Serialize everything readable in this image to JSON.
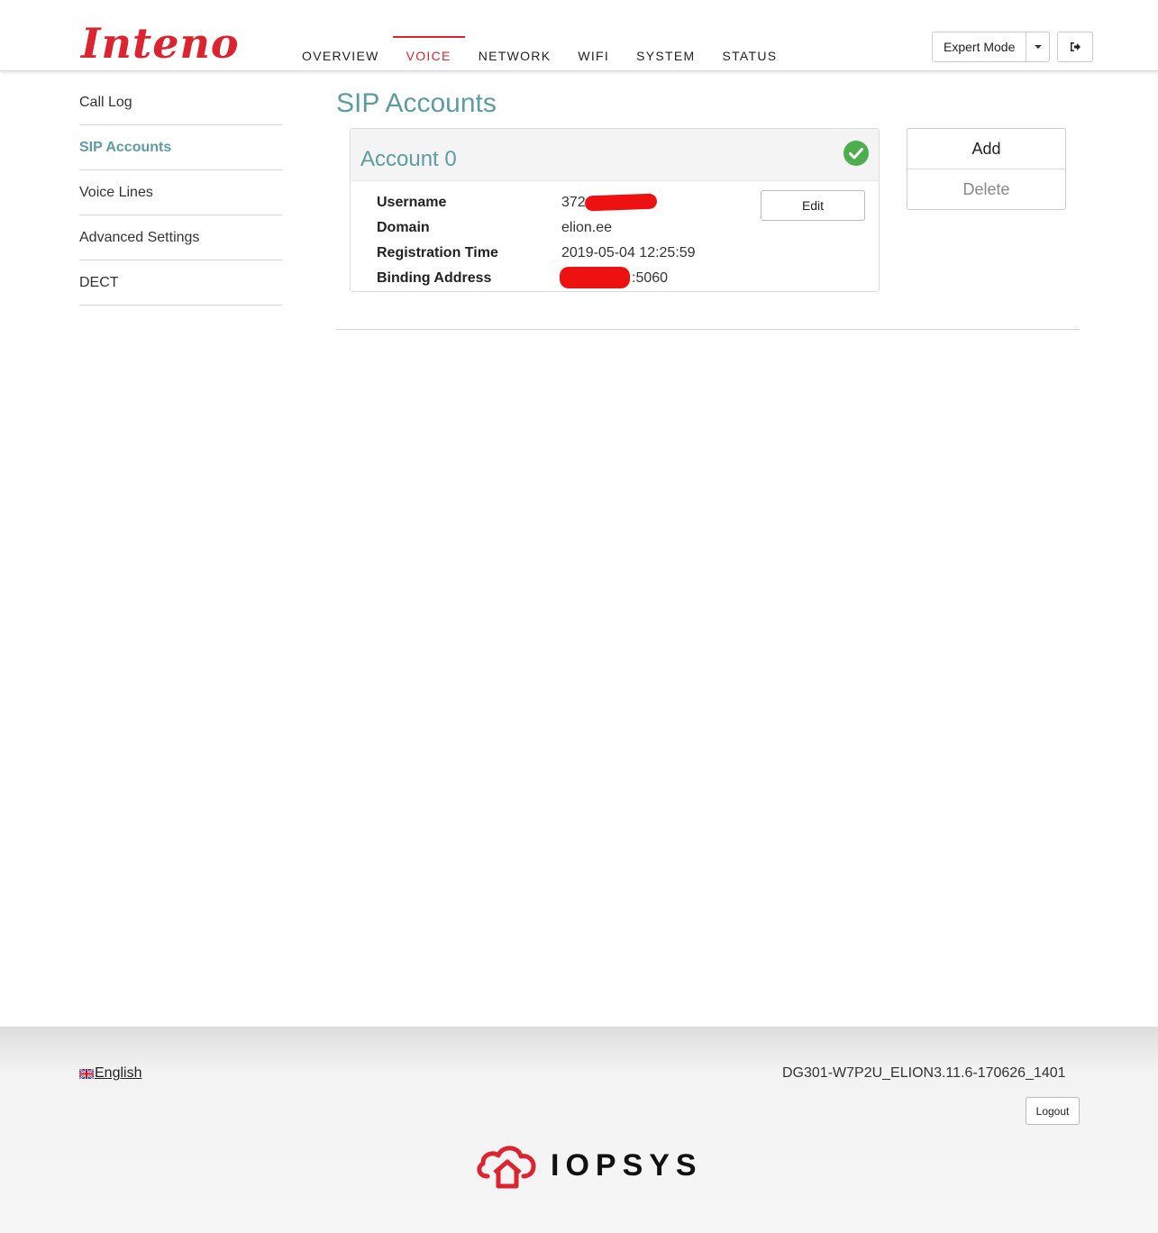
{
  "brand": {
    "logo_text": "Inteno",
    "accent": "#dc2430",
    "teal": "#5d9ca3"
  },
  "nav": {
    "items": [
      {
        "label": "OVERVIEW"
      },
      {
        "label": "VOICE"
      },
      {
        "label": "NETWORK"
      },
      {
        "label": "WIFI"
      },
      {
        "label": "SYSTEM"
      },
      {
        "label": "STATUS"
      }
    ],
    "active": "VOICE"
  },
  "header_controls": {
    "mode_label": "Expert Mode",
    "mode_dropdown_icon": "caret-down-icon",
    "exit_icon": "sign-out-icon"
  },
  "sidebar": {
    "items": [
      {
        "label": "Call Log"
      },
      {
        "label": "SIP Accounts"
      },
      {
        "label": "Voice Lines"
      },
      {
        "label": "Advanced Settings"
      },
      {
        "label": "DECT"
      }
    ],
    "active": "SIP Accounts"
  },
  "main": {
    "title": "SIP Accounts",
    "account": {
      "title": "Account 0",
      "status_icon": "check-circle-icon",
      "rows": [
        {
          "label": "Username",
          "value": "372"
        },
        {
          "label": "Domain",
          "value": "elion.ee"
        },
        {
          "label": "Registration Time",
          "value": "2019-05-04 12:25:59"
        },
        {
          "label": "Binding Address",
          "value": ":5060"
        }
      ],
      "edit_label": "Edit"
    },
    "actions": {
      "add_label": "Add",
      "delete_label": "Delete"
    }
  },
  "footer": {
    "language": "English",
    "flag_icon": "uk-flag-icon",
    "version": "DG301-W7P2U_ELION3.11.6-170626_1401",
    "logout_label": "Logout",
    "vendor_logo_text": "IOPSYS"
  }
}
